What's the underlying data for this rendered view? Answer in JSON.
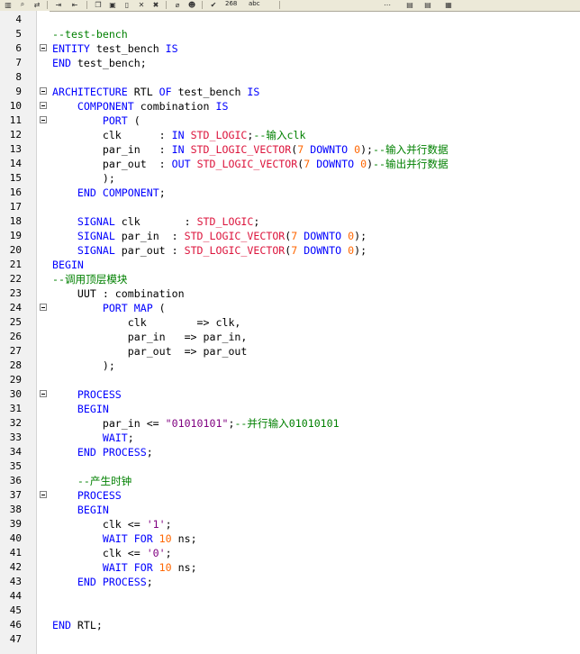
{
  "toolbar": {
    "zoom_value": "268",
    "field_label": "abc"
  },
  "colors": {
    "keyword": "#0000ff",
    "type": "#dc143c",
    "number": "#ff6600",
    "string": "#800080",
    "comment": "#008000"
  },
  "lines": [
    {
      "n": "4",
      "fold": false,
      "tokens": []
    },
    {
      "n": "5",
      "fold": false,
      "tokens": [
        {
          "c": "cm",
          "t": "--test-bench"
        }
      ]
    },
    {
      "n": "6",
      "fold": true,
      "tokens": [
        {
          "c": "kw",
          "t": "ENTITY"
        },
        {
          "c": "",
          "t": " test_bench "
        },
        {
          "c": "kw",
          "t": "IS"
        }
      ]
    },
    {
      "n": "7",
      "fold": false,
      "tokens": [
        {
          "c": "kw",
          "t": "END"
        },
        {
          "c": "",
          "t": " test_bench;"
        }
      ]
    },
    {
      "n": "8",
      "fold": false,
      "tokens": []
    },
    {
      "n": "9",
      "fold": true,
      "tokens": [
        {
          "c": "kw",
          "t": "ARCHITECTURE"
        },
        {
          "c": "",
          "t": " RTL "
        },
        {
          "c": "kw",
          "t": "OF"
        },
        {
          "c": "",
          "t": " test_bench "
        },
        {
          "c": "kw",
          "t": "IS"
        }
      ]
    },
    {
      "n": "10",
      "fold": true,
      "tokens": [
        {
          "c": "",
          "t": "    "
        },
        {
          "c": "kw",
          "t": "COMPONENT"
        },
        {
          "c": "",
          "t": " combination "
        },
        {
          "c": "kw",
          "t": "IS"
        }
      ]
    },
    {
      "n": "11",
      "fold": true,
      "tokens": [
        {
          "c": "",
          "t": "        "
        },
        {
          "c": "kw",
          "t": "PORT"
        },
        {
          "c": "",
          "t": " ("
        }
      ]
    },
    {
      "n": "12",
      "fold": false,
      "tokens": [
        {
          "c": "",
          "t": "        clk      : "
        },
        {
          "c": "kw",
          "t": "IN"
        },
        {
          "c": "",
          "t": " "
        },
        {
          "c": "ty",
          "t": "STD_LOGIC"
        },
        {
          "c": "",
          "t": ";"
        },
        {
          "c": "cm",
          "t": "--输入clk"
        }
      ]
    },
    {
      "n": "13",
      "fold": false,
      "tokens": [
        {
          "c": "",
          "t": "        par_in   : "
        },
        {
          "c": "kw",
          "t": "IN"
        },
        {
          "c": "",
          "t": " "
        },
        {
          "c": "ty",
          "t": "STD_LOGIC_VECTOR"
        },
        {
          "c": "",
          "t": "("
        },
        {
          "c": "num",
          "t": "7"
        },
        {
          "c": "",
          "t": " "
        },
        {
          "c": "kw",
          "t": "DOWNTO"
        },
        {
          "c": "",
          "t": " "
        },
        {
          "c": "num",
          "t": "0"
        },
        {
          "c": "",
          "t": ");"
        },
        {
          "c": "cm",
          "t": "--输入并行数据"
        }
      ]
    },
    {
      "n": "14",
      "fold": false,
      "tokens": [
        {
          "c": "",
          "t": "        par_out  : "
        },
        {
          "c": "kw",
          "t": "OUT"
        },
        {
          "c": "",
          "t": " "
        },
        {
          "c": "ty",
          "t": "STD_LOGIC_VECTOR"
        },
        {
          "c": "",
          "t": "("
        },
        {
          "c": "num",
          "t": "7"
        },
        {
          "c": "",
          "t": " "
        },
        {
          "c": "kw",
          "t": "DOWNTO"
        },
        {
          "c": "",
          "t": " "
        },
        {
          "c": "num",
          "t": "0"
        },
        {
          "c": "",
          "t": ")"
        },
        {
          "c": "cm",
          "t": "--输出并行数据"
        }
      ]
    },
    {
      "n": "15",
      "fold": false,
      "tokens": [
        {
          "c": "",
          "t": "        );"
        }
      ]
    },
    {
      "n": "16",
      "fold": false,
      "tokens": [
        {
          "c": "",
          "t": "    "
        },
        {
          "c": "kw",
          "t": "END"
        },
        {
          "c": "",
          "t": " "
        },
        {
          "c": "kw",
          "t": "COMPONENT"
        },
        {
          "c": "",
          "t": ";"
        }
      ]
    },
    {
      "n": "17",
      "fold": false,
      "tokens": []
    },
    {
      "n": "18",
      "fold": false,
      "tokens": [
        {
          "c": "",
          "t": "    "
        },
        {
          "c": "kw",
          "t": "SIGNAL"
        },
        {
          "c": "",
          "t": " clk       : "
        },
        {
          "c": "ty",
          "t": "STD_LOGIC"
        },
        {
          "c": "",
          "t": ";"
        }
      ]
    },
    {
      "n": "19",
      "fold": false,
      "tokens": [
        {
          "c": "",
          "t": "    "
        },
        {
          "c": "kw",
          "t": "SIGNAL"
        },
        {
          "c": "",
          "t": " par_in  : "
        },
        {
          "c": "ty",
          "t": "STD_LOGIC_VECTOR"
        },
        {
          "c": "",
          "t": "("
        },
        {
          "c": "num",
          "t": "7"
        },
        {
          "c": "",
          "t": " "
        },
        {
          "c": "kw",
          "t": "DOWNTO"
        },
        {
          "c": "",
          "t": " "
        },
        {
          "c": "num",
          "t": "0"
        },
        {
          "c": "",
          "t": ");"
        }
      ]
    },
    {
      "n": "20",
      "fold": false,
      "tokens": [
        {
          "c": "",
          "t": "    "
        },
        {
          "c": "kw",
          "t": "SIGNAL"
        },
        {
          "c": "",
          "t": " par_out : "
        },
        {
          "c": "ty",
          "t": "STD_LOGIC_VECTOR"
        },
        {
          "c": "",
          "t": "("
        },
        {
          "c": "num",
          "t": "7"
        },
        {
          "c": "",
          "t": " "
        },
        {
          "c": "kw",
          "t": "DOWNTO"
        },
        {
          "c": "",
          "t": " "
        },
        {
          "c": "num",
          "t": "0"
        },
        {
          "c": "",
          "t": ");"
        }
      ]
    },
    {
      "n": "21",
      "fold": false,
      "tokens": [
        {
          "c": "kw",
          "t": "BEGIN"
        }
      ]
    },
    {
      "n": "22",
      "fold": false,
      "tokens": [
        {
          "c": "cm",
          "t": "--调用顶层模块"
        }
      ]
    },
    {
      "n": "23",
      "fold": false,
      "tokens": [
        {
          "c": "",
          "t": "    UUT : combination"
        }
      ]
    },
    {
      "n": "24",
      "fold": true,
      "tokens": [
        {
          "c": "",
          "t": "        "
        },
        {
          "c": "kw",
          "t": "PORT MAP"
        },
        {
          "c": "",
          "t": " ("
        }
      ]
    },
    {
      "n": "25",
      "fold": false,
      "tokens": [
        {
          "c": "",
          "t": "            clk        => clk,"
        }
      ]
    },
    {
      "n": "26",
      "fold": false,
      "tokens": [
        {
          "c": "",
          "t": "            par_in   => par_in,"
        }
      ]
    },
    {
      "n": "27",
      "fold": false,
      "tokens": [
        {
          "c": "",
          "t": "            par_out  => par_out"
        }
      ]
    },
    {
      "n": "28",
      "fold": false,
      "tokens": [
        {
          "c": "",
          "t": "        );"
        }
      ]
    },
    {
      "n": "29",
      "fold": false,
      "tokens": []
    },
    {
      "n": "30",
      "fold": true,
      "tokens": [
        {
          "c": "",
          "t": "    "
        },
        {
          "c": "kw",
          "t": "PROCESS"
        }
      ]
    },
    {
      "n": "31",
      "fold": false,
      "tokens": [
        {
          "c": "",
          "t": "    "
        },
        {
          "c": "kw",
          "t": "BEGIN"
        }
      ]
    },
    {
      "n": "32",
      "fold": false,
      "tokens": [
        {
          "c": "",
          "t": "        par_in <= "
        },
        {
          "c": "str",
          "t": "\"01010101\""
        },
        {
          "c": "",
          "t": ";"
        },
        {
          "c": "cm",
          "t": "--并行输入01010101"
        }
      ]
    },
    {
      "n": "33",
      "fold": false,
      "tokens": [
        {
          "c": "",
          "t": "        "
        },
        {
          "c": "kw",
          "t": "WAIT"
        },
        {
          "c": "",
          "t": ";"
        }
      ]
    },
    {
      "n": "34",
      "fold": false,
      "tokens": [
        {
          "c": "",
          "t": "    "
        },
        {
          "c": "kw",
          "t": "END"
        },
        {
          "c": "",
          "t": " "
        },
        {
          "c": "kw",
          "t": "PROCESS"
        },
        {
          "c": "",
          "t": ";"
        }
      ]
    },
    {
      "n": "35",
      "fold": false,
      "tokens": []
    },
    {
      "n": "36",
      "fold": false,
      "tokens": [
        {
          "c": "",
          "t": "    "
        },
        {
          "c": "cm",
          "t": "--产生时钟"
        }
      ]
    },
    {
      "n": "37",
      "fold": true,
      "tokens": [
        {
          "c": "",
          "t": "    "
        },
        {
          "c": "kw",
          "t": "PROCESS"
        }
      ]
    },
    {
      "n": "38",
      "fold": false,
      "tokens": [
        {
          "c": "",
          "t": "    "
        },
        {
          "c": "kw",
          "t": "BEGIN"
        }
      ]
    },
    {
      "n": "39",
      "fold": false,
      "tokens": [
        {
          "c": "",
          "t": "        clk <= "
        },
        {
          "c": "str",
          "t": "'1'"
        },
        {
          "c": "",
          "t": ";"
        }
      ]
    },
    {
      "n": "40",
      "fold": false,
      "tokens": [
        {
          "c": "",
          "t": "        "
        },
        {
          "c": "kw",
          "t": "WAIT FOR"
        },
        {
          "c": "",
          "t": " "
        },
        {
          "c": "num",
          "t": "10"
        },
        {
          "c": "",
          "t": " ns;"
        }
      ]
    },
    {
      "n": "41",
      "fold": false,
      "tokens": [
        {
          "c": "",
          "t": "        clk <= "
        },
        {
          "c": "str",
          "t": "'0'"
        },
        {
          "c": "",
          "t": ";"
        }
      ]
    },
    {
      "n": "42",
      "fold": false,
      "tokens": [
        {
          "c": "",
          "t": "        "
        },
        {
          "c": "kw",
          "t": "WAIT FOR"
        },
        {
          "c": "",
          "t": " "
        },
        {
          "c": "num",
          "t": "10"
        },
        {
          "c": "",
          "t": " ns;"
        }
      ]
    },
    {
      "n": "43",
      "fold": false,
      "tokens": [
        {
          "c": "",
          "t": "    "
        },
        {
          "c": "kw",
          "t": "END"
        },
        {
          "c": "",
          "t": " "
        },
        {
          "c": "kw",
          "t": "PROCESS"
        },
        {
          "c": "",
          "t": ";"
        }
      ]
    },
    {
      "n": "44",
      "fold": false,
      "tokens": []
    },
    {
      "n": "45",
      "fold": false,
      "tokens": []
    },
    {
      "n": "46",
      "fold": false,
      "tokens": [
        {
          "c": "kw",
          "t": "END"
        },
        {
          "c": "",
          "t": " RTL;"
        }
      ]
    },
    {
      "n": "47",
      "fold": false,
      "tokens": []
    }
  ]
}
